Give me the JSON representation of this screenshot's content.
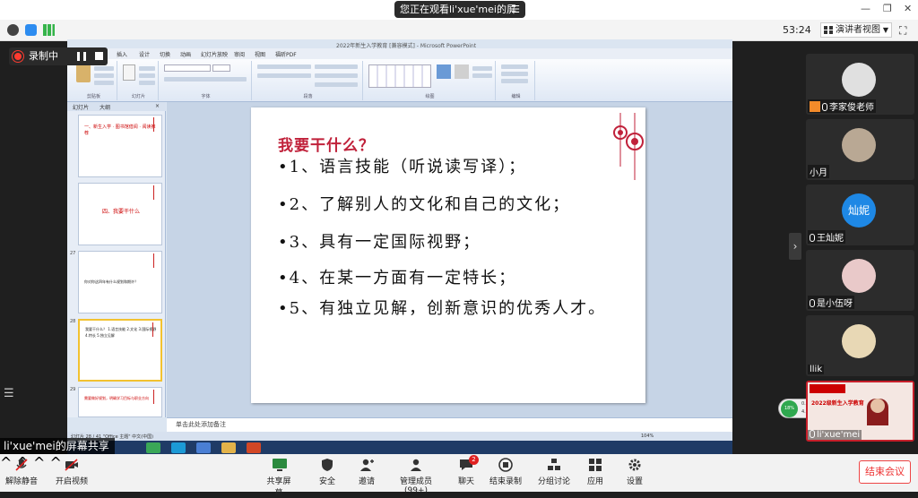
{
  "banner": {
    "text": "您正在观看li'xue'mei的屏幕"
  },
  "topbar": {
    "timer": "53:24",
    "view_mode": "演讲者视图"
  },
  "recording": {
    "label": "录制中"
  },
  "ppt": {
    "window_title": "2022年新生入学教育 [兼容模式] - Microsoft PowerPoint",
    "ribbon_tabs": [
      "开始",
      "插入",
      "设计",
      "切换",
      "动画",
      "幻灯片放映",
      "审阅",
      "视图",
      "福昕PDF"
    ],
    "ribbon_groups": [
      "剪贴板",
      "幻灯片",
      "字体",
      "段落",
      "绘图",
      "编辑"
    ],
    "pane_tabs": [
      "幻灯片",
      "大纲"
    ],
    "thumbs": [
      {
        "num": "",
        "text": "一、新生入学 · 图书馆借阅 · 阅读推荐"
      },
      {
        "num": "",
        "text": "四、我要干什么"
      },
      {
        "num": "27",
        "text": "你对你这四年有什么规划和期许？"
      },
      {
        "num": "28",
        "text": "我要干什么？ 1.语言技能 2.文化 3.国际视野 4.特长 5.独立见解"
      },
      {
        "num": "29",
        "text": "需要做好规划，明确学习目标与职业方向"
      }
    ],
    "slide": {
      "title": "我要干什么？",
      "bullets": [
        "•1、语言技能（听说读写译）；",
        "•2、了解别人的文化和自己的文化；",
        "•3、具有一定国际视野；",
        "•4、在某一方面有一定特长；",
        "•5、有独立见解，创新意识的优秀人才。"
      ]
    },
    "notes_placeholder": "单击此处添加备注",
    "status_text": "幻灯片 28 / 41  \"Office 主题\"  中文(中国)",
    "zoom": "104%",
    "widget_pct": "18%",
    "widget_up": "0.3K/s",
    "widget_down": "4.6K/s"
  },
  "share_label": "li'xue'mei的屏幕共享",
  "participants": [
    {
      "name": "李家俊老师",
      "role": "host",
      "avatar_color": "#d9d9d9"
    },
    {
      "name": "小月",
      "role": "member",
      "avatar_color": "#b9a894"
    },
    {
      "name": "王灿妮",
      "role": "member",
      "avatar_color": "#1e88e5",
      "avatar_text": "灿妮"
    },
    {
      "name": "是小伍呀",
      "role": "member",
      "avatar_color": "#e9c9c9"
    },
    {
      "name": "llik",
      "role": "member",
      "avatar_color": "#e8d8b5"
    },
    {
      "name": "li'xue'mei",
      "role": "presenter",
      "video_caption": "2022级新生入学教育"
    }
  ],
  "bottombar": {
    "unmute": "解除静音",
    "start_video": "开启视频",
    "share_screen": "共享屏幕",
    "security": "安全",
    "invite": "邀请",
    "manage": "管理成员(99+)",
    "chat": "聊天",
    "chat_badge": "2",
    "end_recording": "结束录制",
    "breakout": "分组讨论",
    "apps": "应用",
    "settings": "设置",
    "end_meeting": "结束会议"
  },
  "colors": {
    "accent_red": "#e33333",
    "slide_title": "#c0213a",
    "badge": "#e02020"
  }
}
